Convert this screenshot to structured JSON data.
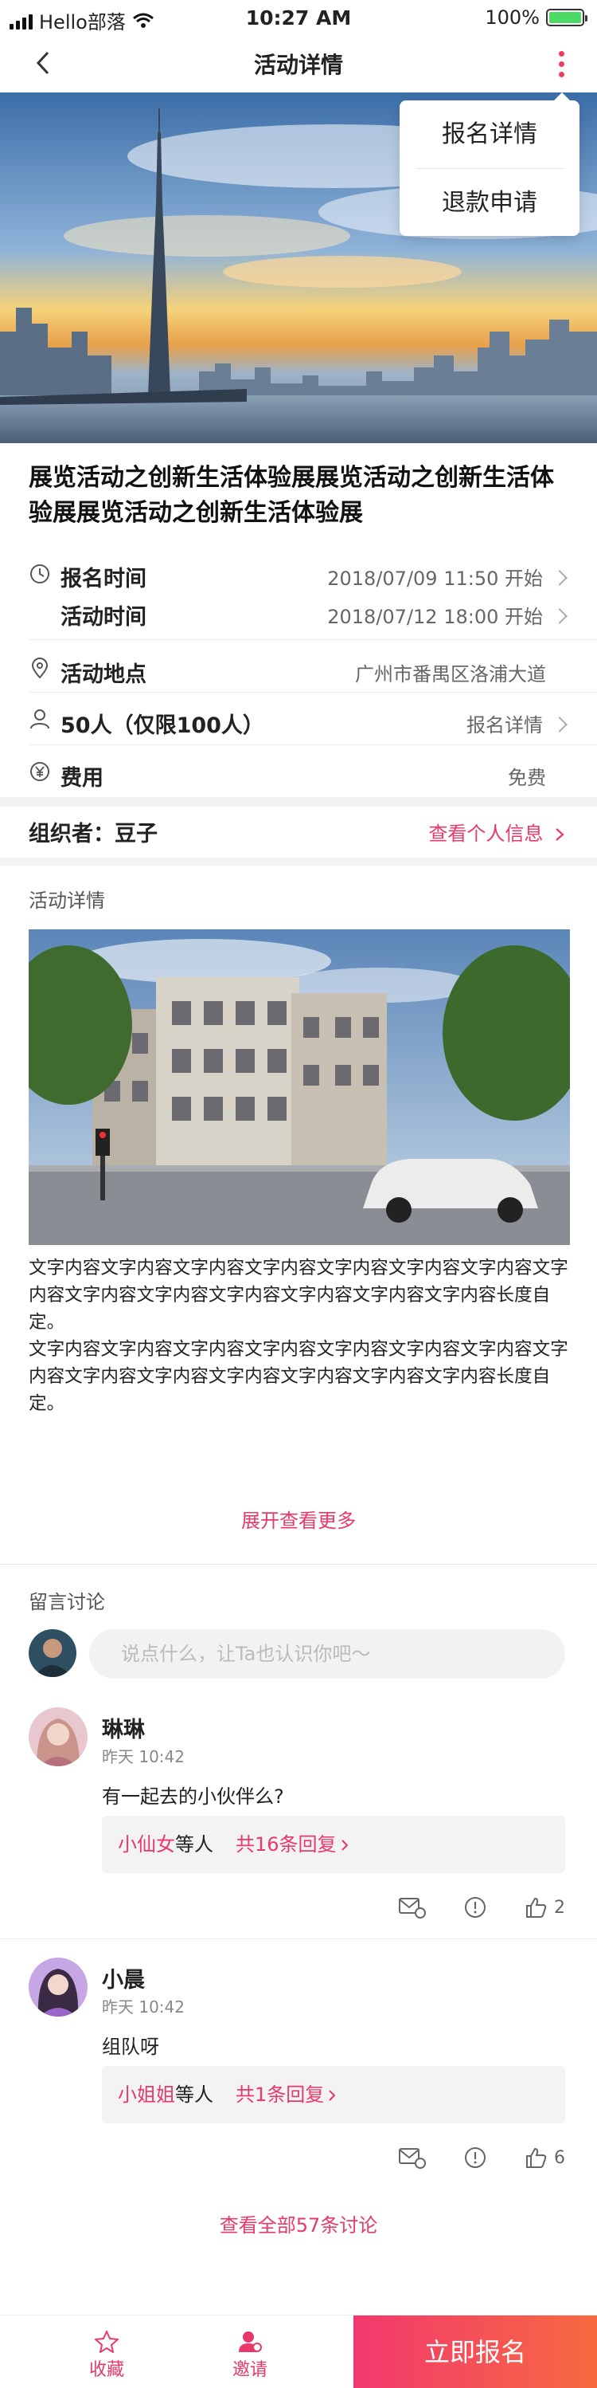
{
  "status_bar": {
    "carrier": "Hello部落",
    "time": "10:27 AM",
    "battery": "100%"
  },
  "nav": {
    "title": "活动详情"
  },
  "dropdown": {
    "items": [
      "报名详情",
      "退款申请"
    ]
  },
  "event": {
    "title": "展览活动之创新生活体验展展览活动之创新生活体验展展览活动之创新生活体验展",
    "signup_time_label": "报名时间",
    "signup_time_value": "2018/07/09 11:50 开始",
    "event_time_label": "活动时间",
    "event_time_value": "2018/07/12 18:00 开始",
    "location_label": "活动地点",
    "location_value": "广州市番禺区洛浦大道",
    "people_label": "50人（仅限100人）",
    "people_link": "报名详情",
    "fee_label": "费用",
    "fee_value": "免费"
  },
  "organizer": {
    "label": "组织者：豆子",
    "link": "查看个人信息"
  },
  "details": {
    "heading": "活动详情",
    "paragraphs": [
      "文字内容文字内容文字内容文字内容文字内容文字内容文字内容文字内容文字内容文字内容文字内容文字内容文字内容文字内容长度自定。",
      "文字内容文字内容文字内容文字内容文字内容文字内容文字内容文字内容文字内容文字内容文字内容文字内容文字内容文字内容长度自定。"
    ],
    "expand": "展开查看更多"
  },
  "comments": {
    "heading": "留言讨论",
    "placeholder": "说点什么，让Ta也认识你吧～",
    "items": [
      {
        "name": "琳琳",
        "time": "昨天 10:42",
        "text": "有一起去的小伙伴么?",
        "reply_who": "小仙女",
        "reply_mid": "等人",
        "reply_count": "共16条回复",
        "likes": "2"
      },
      {
        "name": "小晨",
        "time": "昨天 10:42",
        "text": "组队呀",
        "reply_who": "小姐姐",
        "reply_mid": "等人",
        "reply_count": "共1条回复",
        "likes": "6"
      }
    ],
    "view_all": "查看全部57条讨论"
  },
  "bottom": {
    "favorite": "收藏",
    "invite": "邀请",
    "signup": "立即报名"
  },
  "colors": {
    "accent": "#e8396a",
    "signup_start": "#f2386e",
    "signup_end": "#f76a40"
  }
}
